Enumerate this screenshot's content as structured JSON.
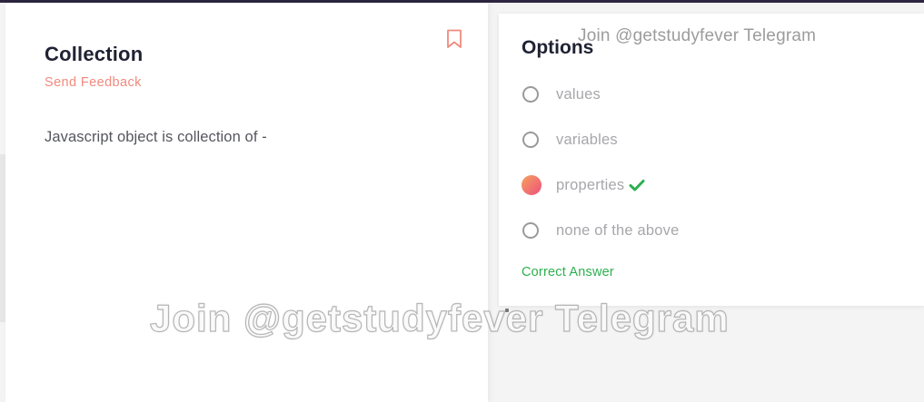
{
  "question": {
    "title": "Collection",
    "feedback_link": "Send Feedback",
    "text": "Javascript object is collection of -"
  },
  "options_panel": {
    "title": "Options",
    "items": [
      {
        "label": "values",
        "selected": false,
        "correct": false
      },
      {
        "label": "variables",
        "selected": false,
        "correct": false
      },
      {
        "label": "properties",
        "selected": true,
        "correct": true
      },
      {
        "label": "none of the above",
        "selected": false,
        "correct": false
      }
    ],
    "result_text": "Correct Answer"
  },
  "watermark": {
    "small": "Join @getstudyfever Telegram",
    "large": "Join @getstudyfever Telegram"
  },
  "colors": {
    "accent": "#f08a7e",
    "success": "#2cb04f",
    "heading": "#1f2233",
    "topbar": "#2c2540"
  },
  "icons": {
    "bookmark": "bookmark-icon",
    "check": "check-icon",
    "selected_radio": "gradient-radio-icon"
  }
}
